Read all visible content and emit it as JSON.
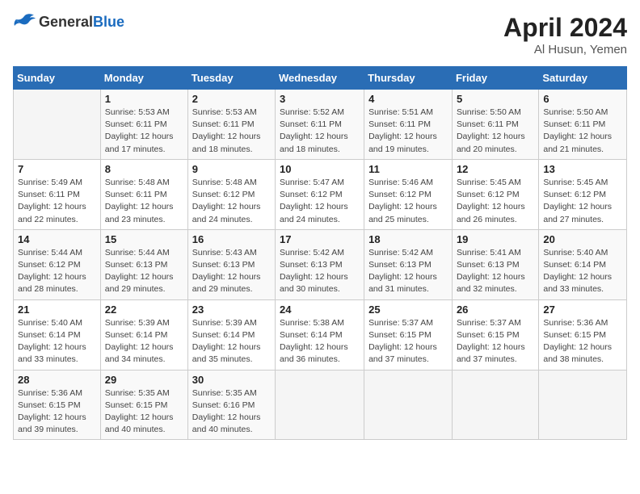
{
  "header": {
    "logo_general": "General",
    "logo_blue": "Blue",
    "month_year": "April 2024",
    "location": "Al Husun, Yemen"
  },
  "columns": [
    "Sunday",
    "Monday",
    "Tuesday",
    "Wednesday",
    "Thursday",
    "Friday",
    "Saturday"
  ],
  "weeks": [
    [
      {
        "day": "",
        "info": ""
      },
      {
        "day": "1",
        "info": "Sunrise: 5:53 AM\nSunset: 6:11 PM\nDaylight: 12 hours\nand 17 minutes."
      },
      {
        "day": "2",
        "info": "Sunrise: 5:53 AM\nSunset: 6:11 PM\nDaylight: 12 hours\nand 18 minutes."
      },
      {
        "day": "3",
        "info": "Sunrise: 5:52 AM\nSunset: 6:11 PM\nDaylight: 12 hours\nand 18 minutes."
      },
      {
        "day": "4",
        "info": "Sunrise: 5:51 AM\nSunset: 6:11 PM\nDaylight: 12 hours\nand 19 minutes."
      },
      {
        "day": "5",
        "info": "Sunrise: 5:50 AM\nSunset: 6:11 PM\nDaylight: 12 hours\nand 20 minutes."
      },
      {
        "day": "6",
        "info": "Sunrise: 5:50 AM\nSunset: 6:11 PM\nDaylight: 12 hours\nand 21 minutes."
      }
    ],
    [
      {
        "day": "7",
        "info": "Sunrise: 5:49 AM\nSunset: 6:11 PM\nDaylight: 12 hours\nand 22 minutes."
      },
      {
        "day": "8",
        "info": "Sunrise: 5:48 AM\nSunset: 6:11 PM\nDaylight: 12 hours\nand 23 minutes."
      },
      {
        "day": "9",
        "info": "Sunrise: 5:48 AM\nSunset: 6:12 PM\nDaylight: 12 hours\nand 24 minutes."
      },
      {
        "day": "10",
        "info": "Sunrise: 5:47 AM\nSunset: 6:12 PM\nDaylight: 12 hours\nand 24 minutes."
      },
      {
        "day": "11",
        "info": "Sunrise: 5:46 AM\nSunset: 6:12 PM\nDaylight: 12 hours\nand 25 minutes."
      },
      {
        "day": "12",
        "info": "Sunrise: 5:45 AM\nSunset: 6:12 PM\nDaylight: 12 hours\nand 26 minutes."
      },
      {
        "day": "13",
        "info": "Sunrise: 5:45 AM\nSunset: 6:12 PM\nDaylight: 12 hours\nand 27 minutes."
      }
    ],
    [
      {
        "day": "14",
        "info": "Sunrise: 5:44 AM\nSunset: 6:12 PM\nDaylight: 12 hours\nand 28 minutes."
      },
      {
        "day": "15",
        "info": "Sunrise: 5:44 AM\nSunset: 6:13 PM\nDaylight: 12 hours\nand 29 minutes."
      },
      {
        "day": "16",
        "info": "Sunrise: 5:43 AM\nSunset: 6:13 PM\nDaylight: 12 hours\nand 29 minutes."
      },
      {
        "day": "17",
        "info": "Sunrise: 5:42 AM\nSunset: 6:13 PM\nDaylight: 12 hours\nand 30 minutes."
      },
      {
        "day": "18",
        "info": "Sunrise: 5:42 AM\nSunset: 6:13 PM\nDaylight: 12 hours\nand 31 minutes."
      },
      {
        "day": "19",
        "info": "Sunrise: 5:41 AM\nSunset: 6:13 PM\nDaylight: 12 hours\nand 32 minutes."
      },
      {
        "day": "20",
        "info": "Sunrise: 5:40 AM\nSunset: 6:14 PM\nDaylight: 12 hours\nand 33 minutes."
      }
    ],
    [
      {
        "day": "21",
        "info": "Sunrise: 5:40 AM\nSunset: 6:14 PM\nDaylight: 12 hours\nand 33 minutes."
      },
      {
        "day": "22",
        "info": "Sunrise: 5:39 AM\nSunset: 6:14 PM\nDaylight: 12 hours\nand 34 minutes."
      },
      {
        "day": "23",
        "info": "Sunrise: 5:39 AM\nSunset: 6:14 PM\nDaylight: 12 hours\nand 35 minutes."
      },
      {
        "day": "24",
        "info": "Sunrise: 5:38 AM\nSunset: 6:14 PM\nDaylight: 12 hours\nand 36 minutes."
      },
      {
        "day": "25",
        "info": "Sunrise: 5:37 AM\nSunset: 6:15 PM\nDaylight: 12 hours\nand 37 minutes."
      },
      {
        "day": "26",
        "info": "Sunrise: 5:37 AM\nSunset: 6:15 PM\nDaylight: 12 hours\nand 37 minutes."
      },
      {
        "day": "27",
        "info": "Sunrise: 5:36 AM\nSunset: 6:15 PM\nDaylight: 12 hours\nand 38 minutes."
      }
    ],
    [
      {
        "day": "28",
        "info": "Sunrise: 5:36 AM\nSunset: 6:15 PM\nDaylight: 12 hours\nand 39 minutes."
      },
      {
        "day": "29",
        "info": "Sunrise: 5:35 AM\nSunset: 6:15 PM\nDaylight: 12 hours\nand 40 minutes."
      },
      {
        "day": "30",
        "info": "Sunrise: 5:35 AM\nSunset: 6:16 PM\nDaylight: 12 hours\nand 40 minutes."
      },
      {
        "day": "",
        "info": ""
      },
      {
        "day": "",
        "info": ""
      },
      {
        "day": "",
        "info": ""
      },
      {
        "day": "",
        "info": ""
      }
    ]
  ]
}
